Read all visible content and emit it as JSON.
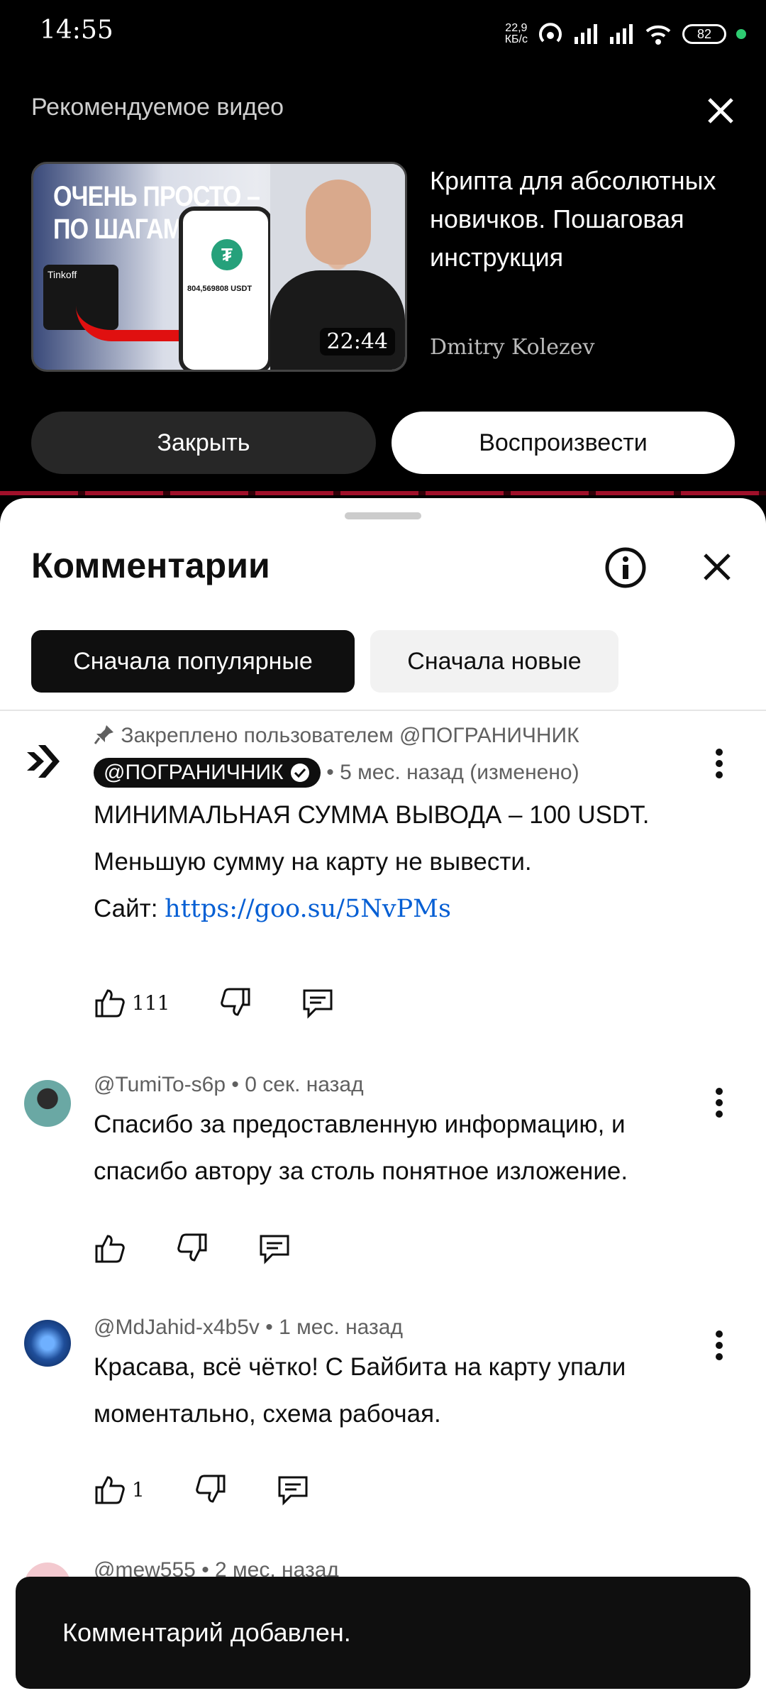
{
  "status": {
    "time": "14:55",
    "speed_top": "22,9",
    "speed_bottom": "КБ/с",
    "battery": "82"
  },
  "recommended": {
    "header": "Рекомендуемое видео",
    "thumb_line1": "ОЧЕНЬ ПРОСТО –",
    "thumb_line2": "ПО ШАГАМ",
    "thumb_card": "Tinkoff",
    "thumb_amount": "804,569808 USDT",
    "duration": "22:44",
    "title": "Крипта для абсолютных новичков. Пошаговая инструкция",
    "author": "Dmitry Kolezev",
    "close_label": "Закрыть",
    "play_label": "Воспроизвести"
  },
  "comments": {
    "title": "Комментарии",
    "sort_popular": "Сначала популярные",
    "sort_new": "Сначала новые",
    "items": [
      {
        "pinned": "Закреплено пользователем @ПОГРАНИЧНИК",
        "author": "@ПОГРАНИЧНИК",
        "time": "• 5 мес. назад (изменено)",
        "line1": "МИНИМАЛЬНАЯ СУММА ВЫВОДА – 100 USDT.",
        "line2": "Меньшую сумму на карту не вывести.",
        "line3_prefix": "Сайт: ",
        "link": "https://goo.su/5NvPMs",
        "likes": "111"
      },
      {
        "author": "@TumiTo-s6p",
        "time": "• 0 сек. назад",
        "text": "Спасибо за предоставленную информацию, и спасибо автору за столь понятное изложение.",
        "likes": ""
      },
      {
        "author": "@MdJahid-x4b5v",
        "time": "• 1 мес. назад",
        "text": "Красава, всё чётко! С Байбита на карту упали моментально, схема рабочая.",
        "likes": "1"
      },
      {
        "author": "@mew555",
        "time": "• 2 мес. назад"
      }
    ]
  },
  "toast": "Комментарий добавлен."
}
